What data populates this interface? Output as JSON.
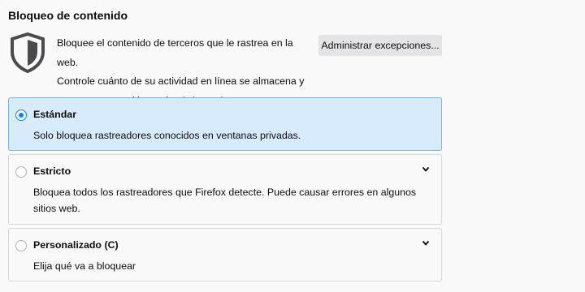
{
  "section": {
    "title": "Bloqueo de contenido",
    "description_line1": "Bloquee el contenido de terceros que le rastrea en la web.",
    "description_line2": "Controle cuánto de su actividad en línea se almacena y",
    "description_line3": "comparte entre sitios web.",
    "learn_more": "Saber más",
    "exceptions_button": "Administrar excepciones...",
    "icon": "shield-icon"
  },
  "options": [
    {
      "label": "Estándar",
      "description": "Solo bloquea rastreadores conocidos en ventanas privadas.",
      "selected": true
    },
    {
      "label": "Estricto",
      "description": "Bloquea todos los rastreadores que Firefox detecte. Puede causar errores en algunos sitios web.",
      "selected": false,
      "icon": "chevron-down-icon"
    },
    {
      "label": "Personalizado (C)",
      "description": "Elija qué va a bloquear",
      "selected": false,
      "icon": "chevron-down-icon"
    }
  ],
  "colors": {
    "accent": "#0a84ff",
    "selected_bg": "#d7ebfd",
    "page_bg": "#f9f9fa"
  }
}
